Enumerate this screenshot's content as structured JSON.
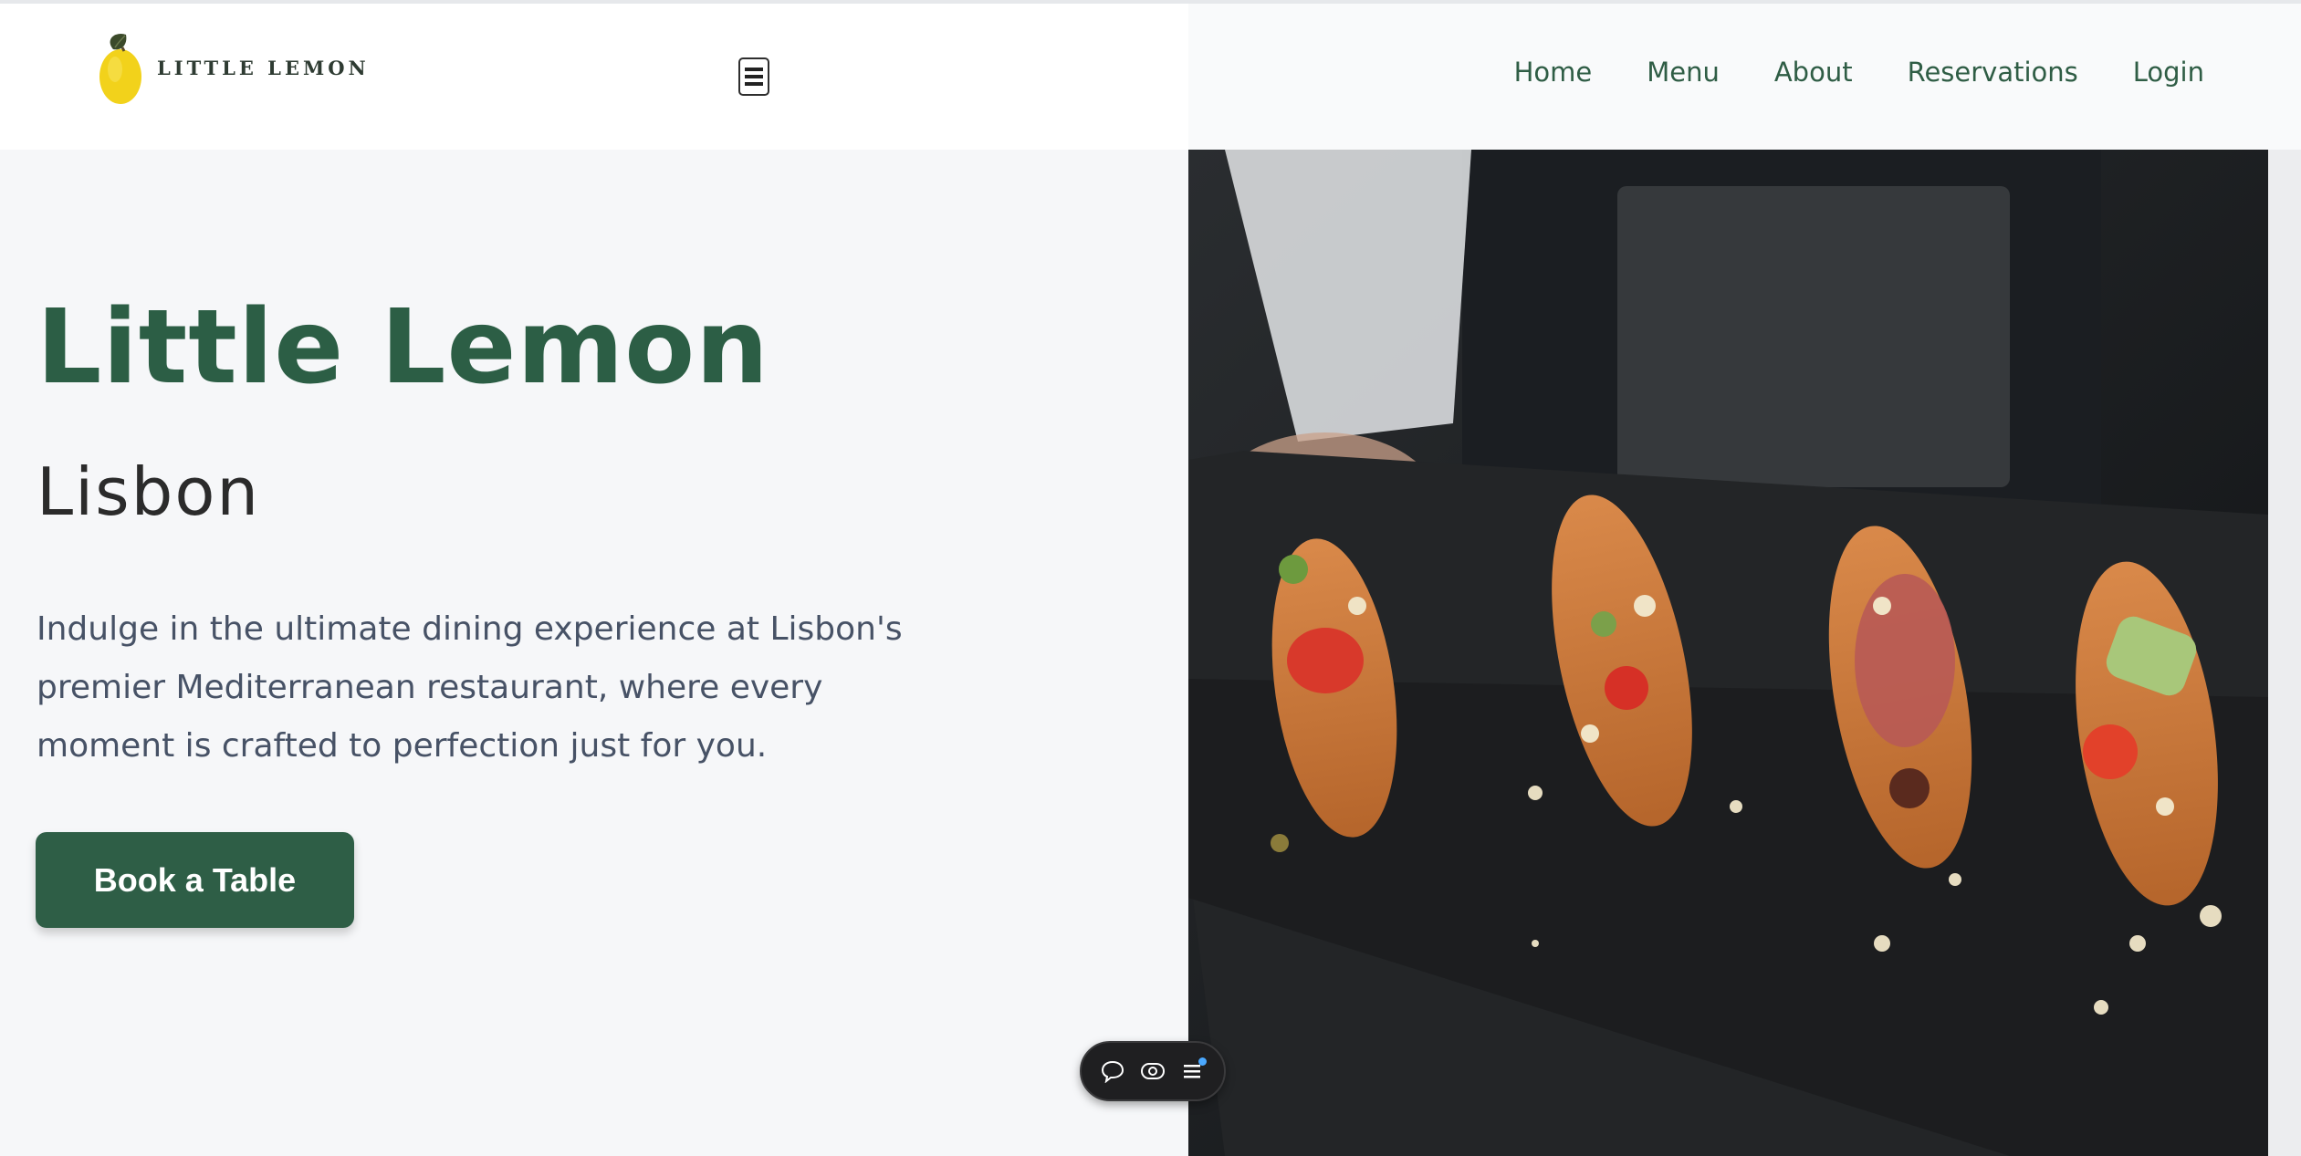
{
  "brand": {
    "logo_text": "LITTLE LEMON",
    "logo_icon": "lemon-icon"
  },
  "header": {
    "menu_toggle_icon": "hamburger-menu-icon",
    "nav": [
      {
        "label": "Home"
      },
      {
        "label": "Menu"
      },
      {
        "label": "About"
      },
      {
        "label": "Reservations"
      },
      {
        "label": "Login"
      }
    ]
  },
  "hero": {
    "title": "Little Lemon",
    "city": "Lisbon",
    "description": "Indulge in the ultimate dining experience at Lisbon's premier Mediterranean restaurant, where every moment is crafted to perfection just for you.",
    "cta_label": "Book a Table",
    "image_subject": "waiter holding slate board with four savory eclairs"
  },
  "floating_toolbar": {
    "buttons": [
      {
        "icon": "comment-icon"
      },
      {
        "icon": "eye-icon"
      },
      {
        "icon": "list-menu-icon",
        "has_notification": true
      }
    ]
  },
  "colors": {
    "brand_green": "#2e5e46",
    "nav_text": "#2f5d45",
    "body_text": "#475266",
    "page_background": "#f6f7f9",
    "lemon_yellow": "#f2d21b"
  }
}
